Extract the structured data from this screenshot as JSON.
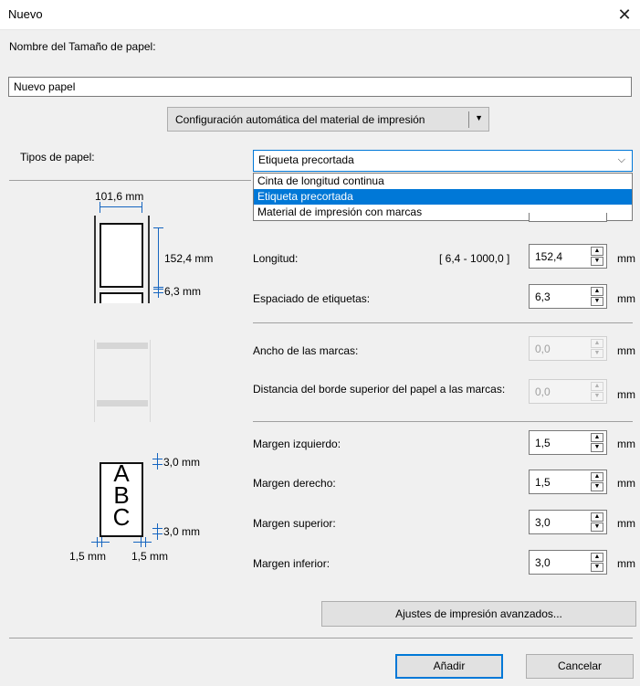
{
  "window": {
    "title": "Nuevo"
  },
  "name_section": {
    "label": "Nombre del Tamaño de papel:",
    "value": "Nuevo papel"
  },
  "auto_config_button": {
    "label": "Configuración automática del material de impresión"
  },
  "paper_type": {
    "label": "Tipos de papel:",
    "selected": "Etiqueta precortada",
    "options": [
      "Cinta de longitud continua",
      "Etiqueta precortada",
      "Material de impresión con marcas"
    ]
  },
  "fields": {
    "longitud": {
      "label": "Longitud:",
      "range": "[ 6,4 - 1000,0 ]",
      "value": "152,4",
      "unit": "mm"
    },
    "espaciado": {
      "label": "Espaciado de etiquetas:",
      "value": "6,3",
      "unit": "mm"
    },
    "ancho_marcas": {
      "label": "Ancho de las marcas:",
      "value": "0,0",
      "unit": "mm"
    },
    "distancia": {
      "label": "Distancia del borde superior del papel a las marcas:",
      "value": "0,0",
      "unit": "mm"
    },
    "margen_izq": {
      "label": "Margen izquierdo:",
      "value": "1,5",
      "unit": "mm"
    },
    "margen_der": {
      "label": "Margen derecho:",
      "value": "1,5",
      "unit": "mm"
    },
    "margen_sup": {
      "label": "Margen superior:",
      "value": "3,0",
      "unit": "mm"
    },
    "margen_inf": {
      "label": "Margen inferior:",
      "value": "3,0",
      "unit": "mm"
    }
  },
  "diagram": {
    "width": "101,6 mm",
    "length": "152,4 mm",
    "gap": "6,3 mm",
    "top_margin": "3,0 mm",
    "bottom_margin": "3,0 mm",
    "left_margin": "1,5 mm",
    "right_margin": "1,5 mm",
    "sample_text": [
      "A",
      "B",
      "C"
    ]
  },
  "advanced_button": {
    "label": "Ajustes de impresión avanzados..."
  },
  "footer": {
    "add": "Añadir",
    "cancel": "Cancelar"
  }
}
